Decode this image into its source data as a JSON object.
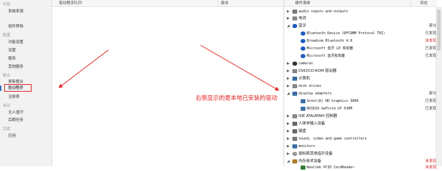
{
  "sidebar": {
    "sections": [
      {
        "header": "开始",
        "items": [
          "系统来源",
          "组件移除"
        ]
      },
      {
        "header": "配置",
        "items": [
          "功能设置",
          "设置",
          "服务",
          "其他服务"
        ]
      },
      {
        "header": "整合",
        "items": [
          "更新整合",
          "驱动程序",
          "注册表"
        ]
      },
      {
        "header": "自动",
        "items": [
          "无人值守",
          "后期任务"
        ]
      },
      {
        "header": "完成",
        "items": [
          "应用"
        ]
      }
    ],
    "active_item": "驱动程序"
  },
  "driver_panel": {
    "col_driver": "驱动程序队列",
    "col_version": "版本"
  },
  "hardware_panel": {
    "col_hardware": "硬件清单",
    "col_status": "状态",
    "rows": [
      {
        "label": "audio inputs and outputs",
        "status": ""
      },
      {
        "label": "电池",
        "status": ""
      },
      {
        "label": "蓝牙",
        "status": "部分"
      },
      {
        "label": "Bluetooth Device (RFCOMM Protocol TDI)",
        "status": "已发现"
      },
      {
        "label": "Broadcom Bluetooth 4.0",
        "status": "未发现"
      },
      {
        "label": "Microsoft 蓝牙 LE 枚举器",
        "status": "已发现"
      },
      {
        "label": "Microsoft 蓝牙枚举器",
        "status": "已发现"
      },
      {
        "label": "cameras",
        "status": ""
      },
      {
        "label": "DVD/CD-ROM 驱动器",
        "status": ""
      },
      {
        "label": "计算机",
        "status": ""
      },
      {
        "label": "disk drives",
        "status": ""
      },
      {
        "label": "display adapters",
        "status": "部分"
      },
      {
        "label": "Intel(R) HD Graphics 3000",
        "status": "已发现"
      },
      {
        "label": "NVIDIA GeForce GT 630M",
        "status": "已发现"
      },
      {
        "label": "IDE ATA/ATAPI 控制器",
        "status": ""
      },
      {
        "label": "人体学输入设备",
        "status": ""
      },
      {
        "label": "键盘",
        "status": ""
      },
      {
        "label": "sound, video and game controllers",
        "status": ""
      },
      {
        "label": "monitors",
        "status": ""
      },
      {
        "label": "鼠标和其他指针设备",
        "status": ""
      },
      {
        "label": "内存技术设备",
        "status": "未发现"
      },
      {
        "label": "Realtek PCIE CardReader",
        "status": "未发现"
      }
    ]
  },
  "annotation": {
    "text": "右侧显示的是本地已安装的驱动",
    "color": "#e02020"
  },
  "colors": {
    "missing": "#d62222",
    "found": "#333333"
  }
}
